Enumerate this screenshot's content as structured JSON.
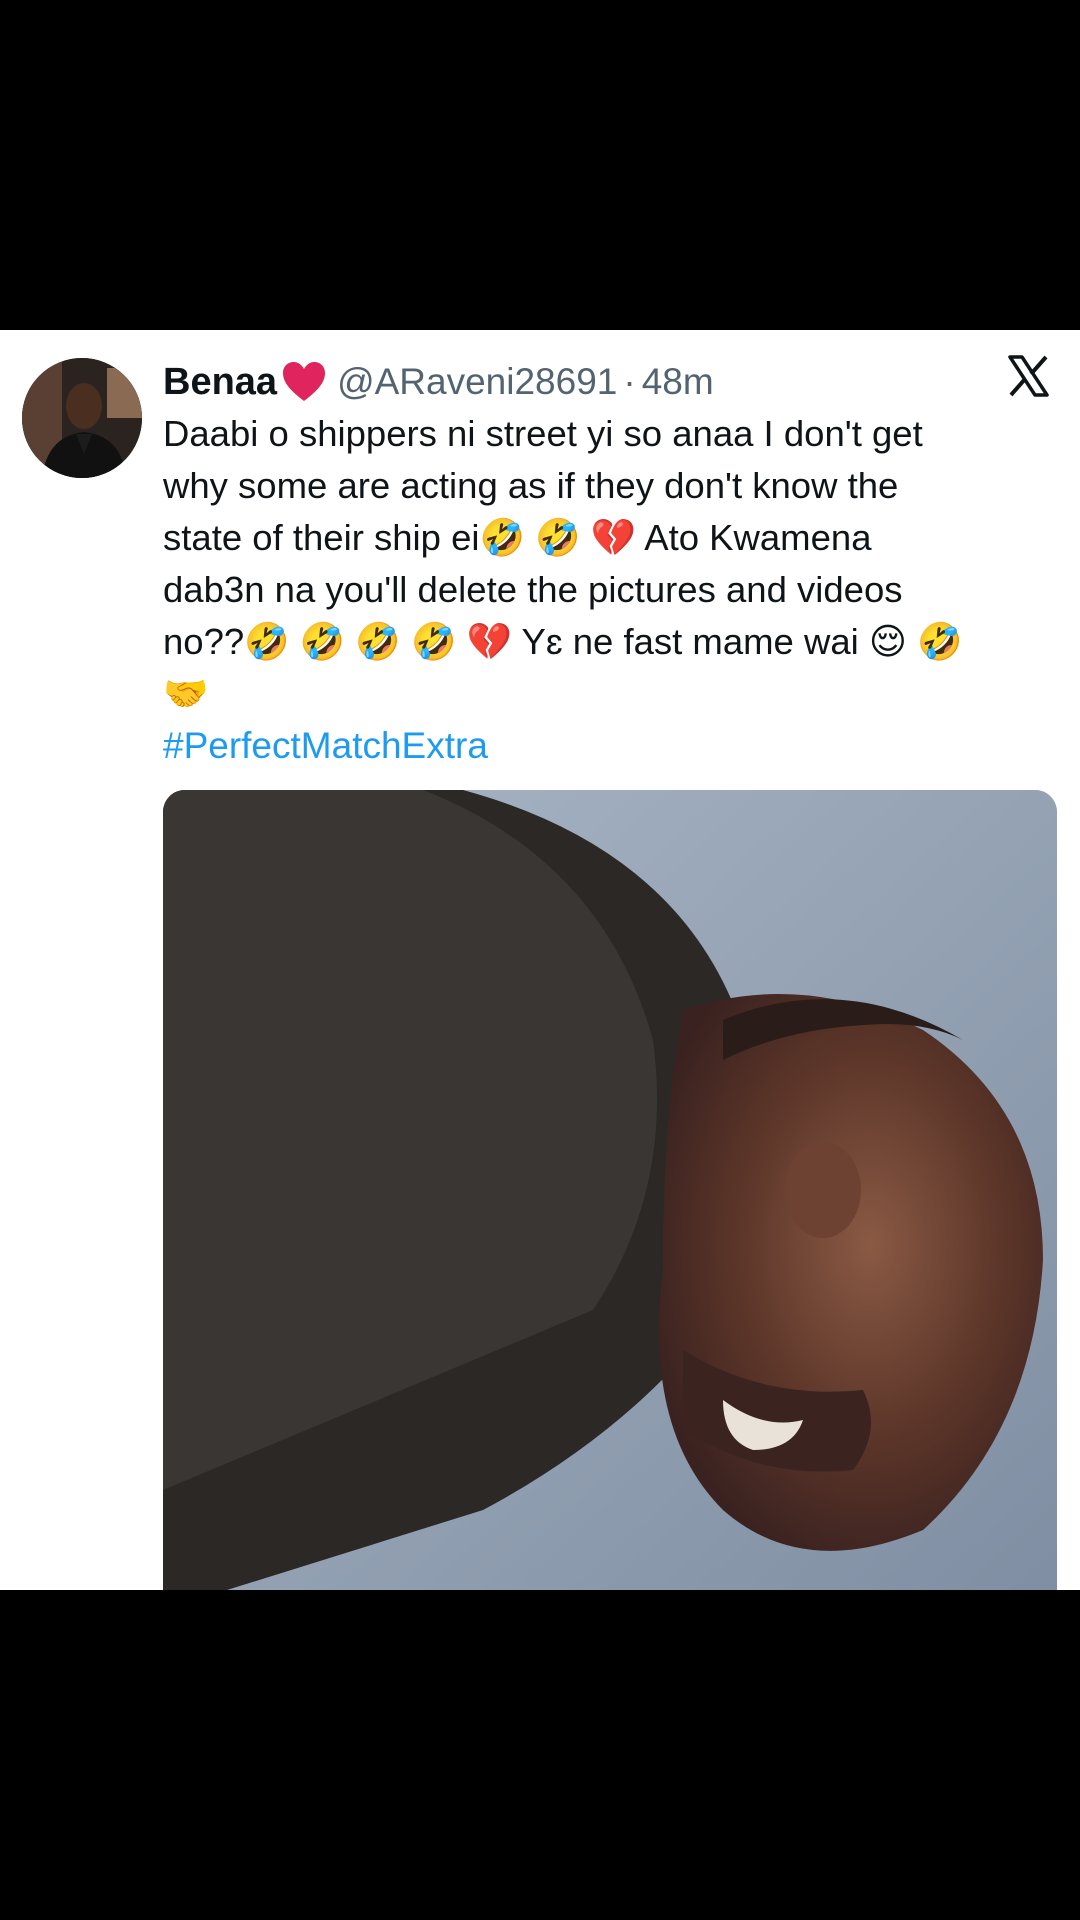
{
  "tweet": {
    "display_name": "Benaa",
    "name_emoji": "heart-icon",
    "handle": "@ARaveni28691",
    "separator": "·",
    "time": "48m",
    "text_lines": [
      "Daabi o shippers ni street yi so anaa I don't get",
      "why some are acting as if they don't know the",
      "state of their ship ei🤣 🤣 💔  Ato Kwamena",
      "dab3n na you'll delete the pictures and videos",
      "no??🤣 🤣 🤣 🤣 💔  Yɛ ne fast mame wai  😌 🤣",
      "🤝"
    ],
    "hashtag": "#PerfectMatchExtra"
  },
  "colors": {
    "text": "#0f1419",
    "secondary": "#536471",
    "link": "#1d9bf0",
    "heart": "#e0245e"
  },
  "icons": {
    "brand": "x-logo-icon",
    "avatar": "avatar"
  }
}
